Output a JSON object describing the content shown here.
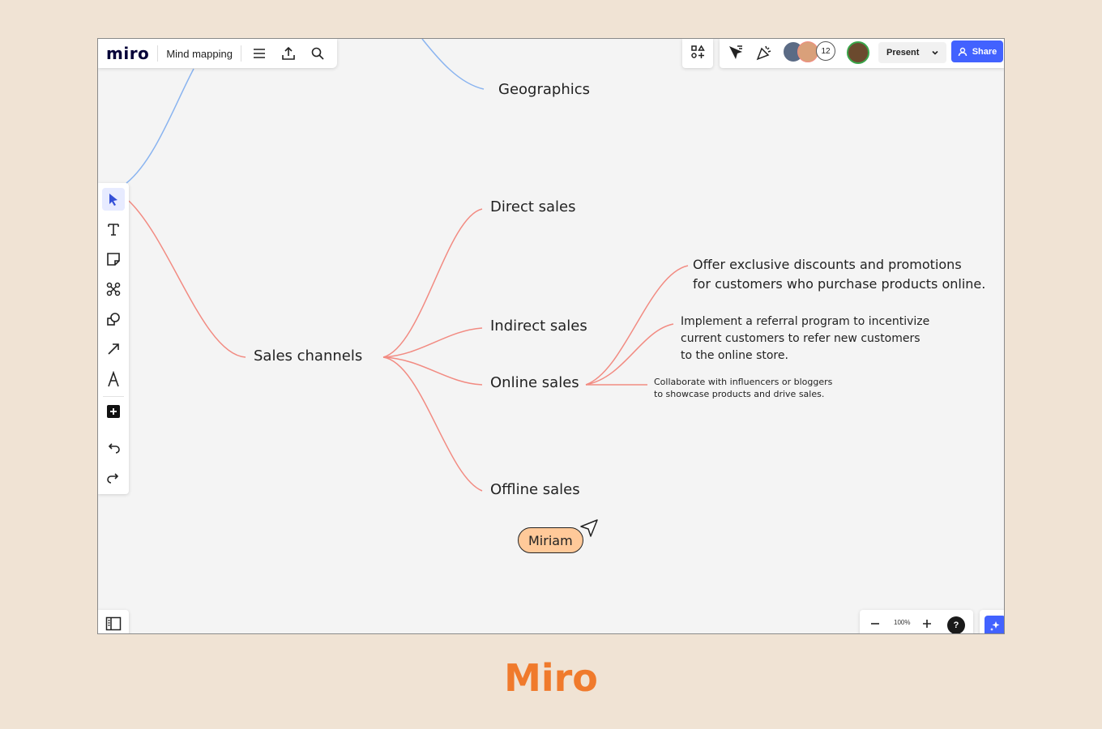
{
  "app": {
    "logo": "miro",
    "board_name": "Mind mapping"
  },
  "top_right": {
    "collaborator_count": "12",
    "present_label": "Present",
    "share_label": "Share"
  },
  "mindmap": {
    "geographics": "Geographics",
    "sales_channels": "Sales channels",
    "direct_sales": "Direct sales",
    "indirect_sales": "Indirect sales",
    "online_sales": "Online sales",
    "offline_sales": "Offline sales",
    "online_idea_1": [
      "Offer exclusive discounts and promotions",
      "for customers who purchase products online."
    ],
    "online_idea_2": [
      "Implement a referral program to incentivize",
      "current customers to refer new customers",
      "to the online store."
    ],
    "online_idea_3": [
      "Collaborate with influencers or bloggers",
      "to showcase products and drive sales."
    ]
  },
  "branch_colors": {
    "blue": "#8ab4f0",
    "red": "#f28b82"
  },
  "cursor": {
    "user": "Miriam",
    "tag_color": "#ffc999"
  },
  "side_tools": [
    "select-icon",
    "text-icon",
    "sticky-note-icon",
    "frame-icon",
    "shapes-icon",
    "arrow-icon",
    "pen-icon",
    "add-icon",
    "undo-icon",
    "redo-icon"
  ],
  "zoom": {
    "level": "100%",
    "help": "?"
  },
  "caption": "Miro"
}
